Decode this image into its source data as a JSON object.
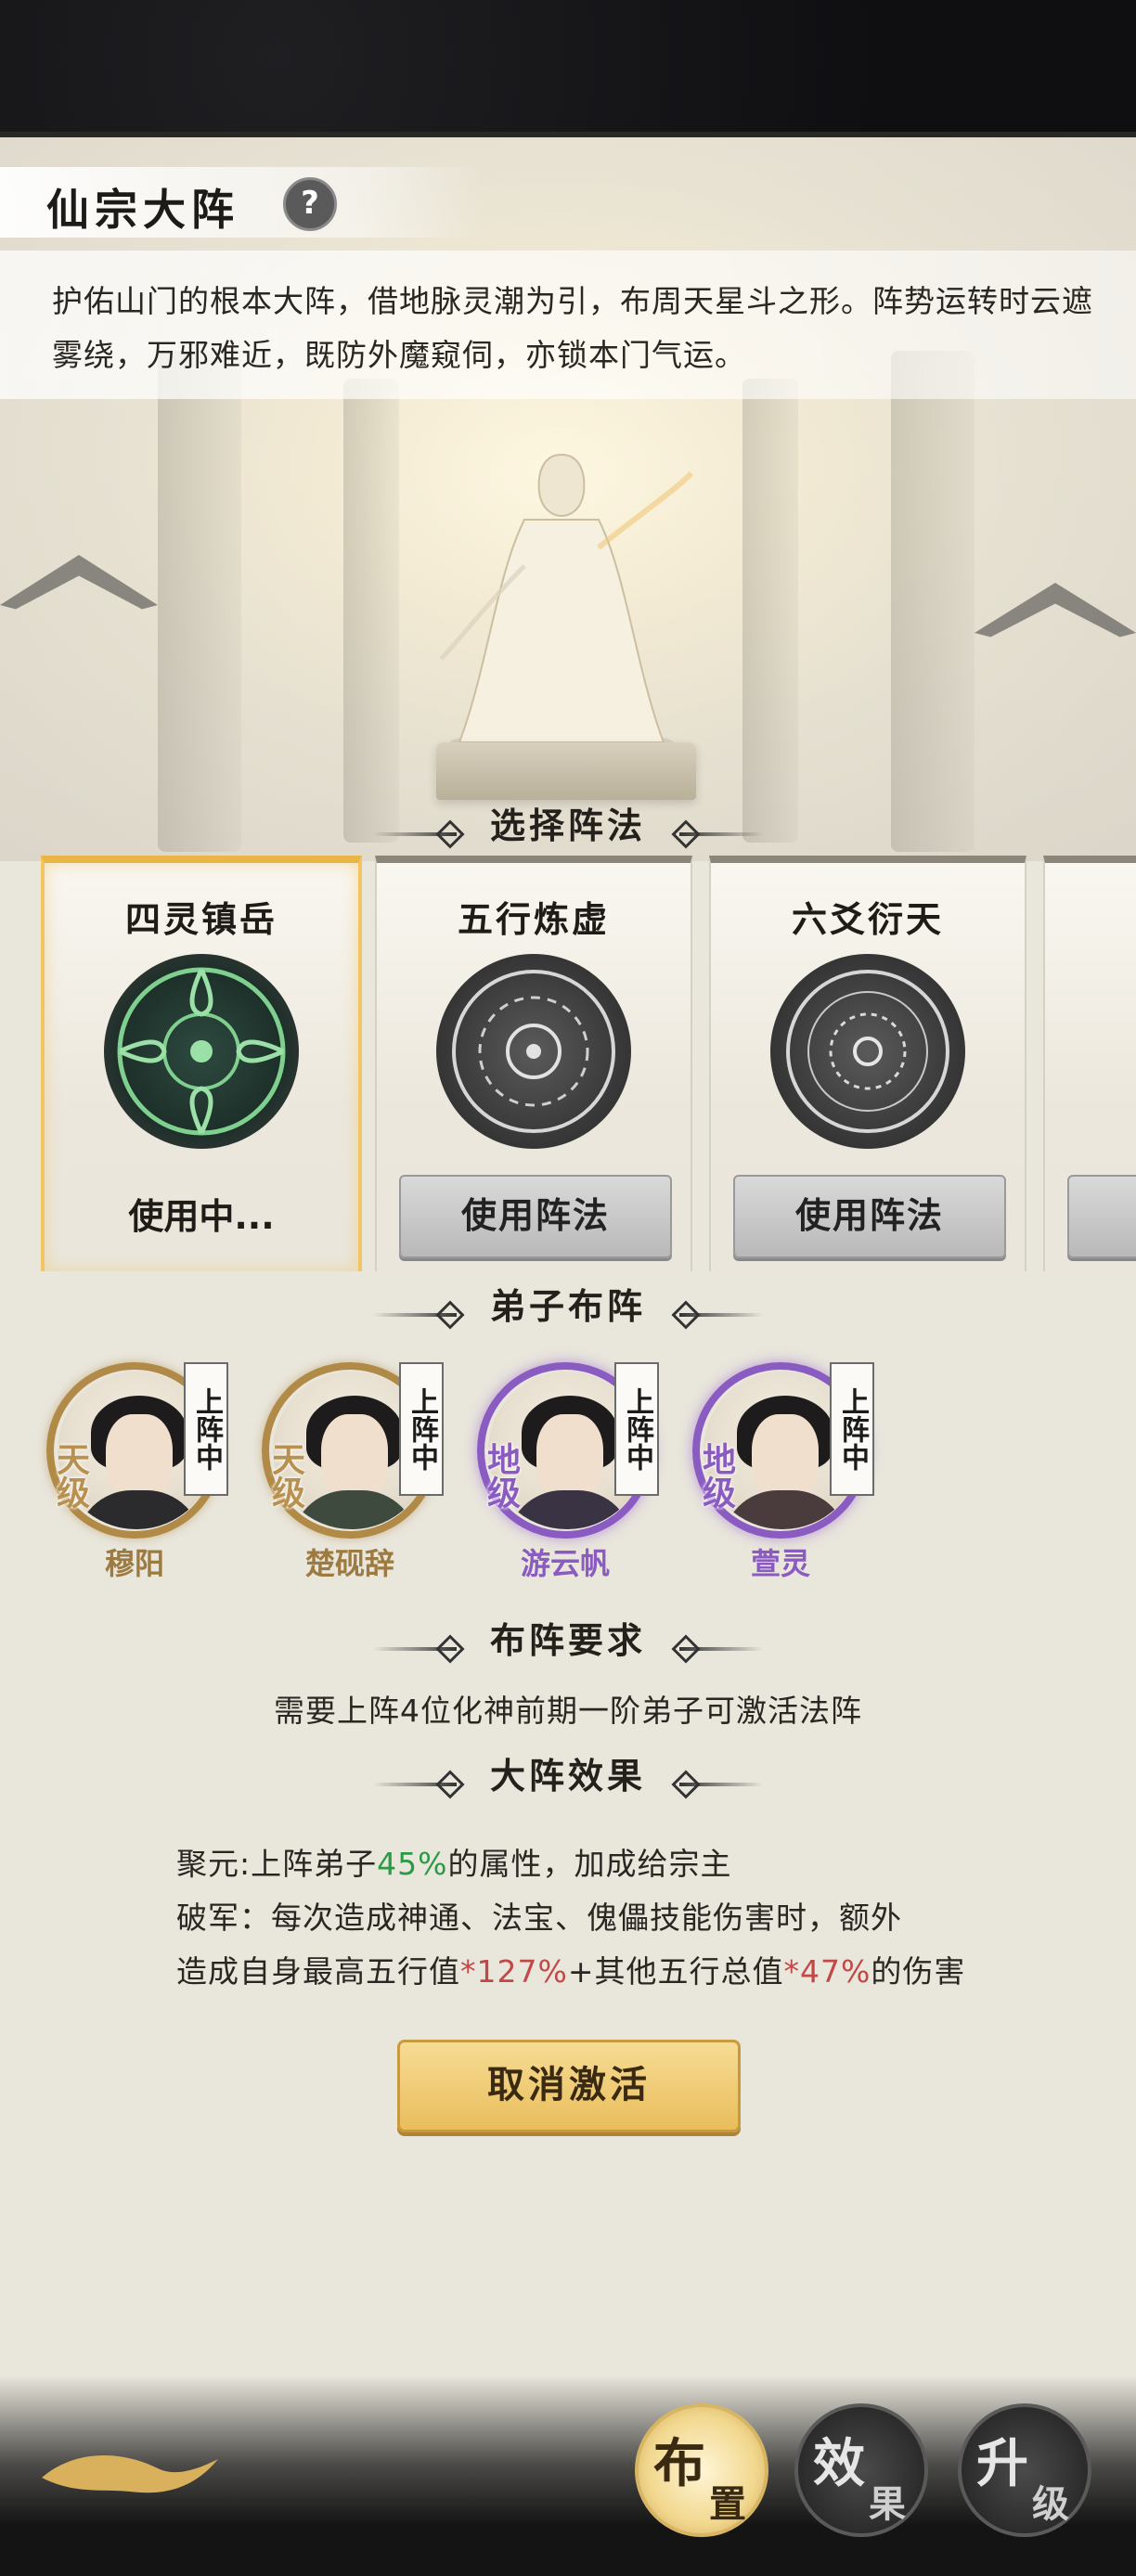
{
  "header": {
    "title": "仙宗大阵",
    "help_label": "?"
  },
  "description": "护佑山门的根本大阵，借地脉灵潮为引，布周天星斗之形。阵势运转时云遮雾绕，万邪难近，既防外魔窥伺，亦锁本门气运。",
  "sections": {
    "choose": "选择阵法",
    "disciples": "弟子布阵",
    "requirement": "布阵要求",
    "effect": "大阵效果"
  },
  "formations": [
    {
      "name": "四灵镇岳",
      "status": "使用中...",
      "active": true
    },
    {
      "name": "五行炼虚",
      "button": "使用阵法",
      "active": false
    },
    {
      "name": "六爻衍天",
      "button": "使用阵法",
      "active": false
    }
  ],
  "disciples": [
    {
      "name": "穆阳",
      "grade": "天级",
      "tag": "上阵中",
      "tier": "gold"
    },
    {
      "name": "楚砚辞",
      "grade": "天级",
      "tag": "上阵中",
      "tier": "gold"
    },
    {
      "name": "游云帆",
      "grade": "地级",
      "tag": "上阵中",
      "tier": "purple"
    },
    {
      "name": "萱灵",
      "grade": "地级",
      "tag": "上阵中",
      "tier": "purple"
    }
  ],
  "requirement_text": "需要上阵4位化神前期一阶弟子可激活法阵",
  "effects": {
    "line1": {
      "pre": "聚元:上阵弟子",
      "value": "45%",
      "post": "的属性，加成给宗主"
    },
    "line2": "破军：每次造成神通、法宝、傀儡技能伤害时，额外",
    "line3": {
      "a": "造成自身最高五行值",
      "v1": "*127%",
      "b": "+其他五行总值",
      "v2": "*47%",
      "c": "的伤害"
    }
  },
  "cancel_button": "取消激活",
  "nav": [
    {
      "big": "布",
      "small": "置",
      "active": true
    },
    {
      "big": "效",
      "small": "果",
      "active": false
    },
    {
      "big": "升",
      "small": "级",
      "active": false
    }
  ],
  "colors": {
    "accent_gold": "#e9b545",
    "positive": "#2a9a45",
    "negative": "#c24848",
    "tier_gold": "#b08a46",
    "tier_purple": "#8a5bc0"
  }
}
